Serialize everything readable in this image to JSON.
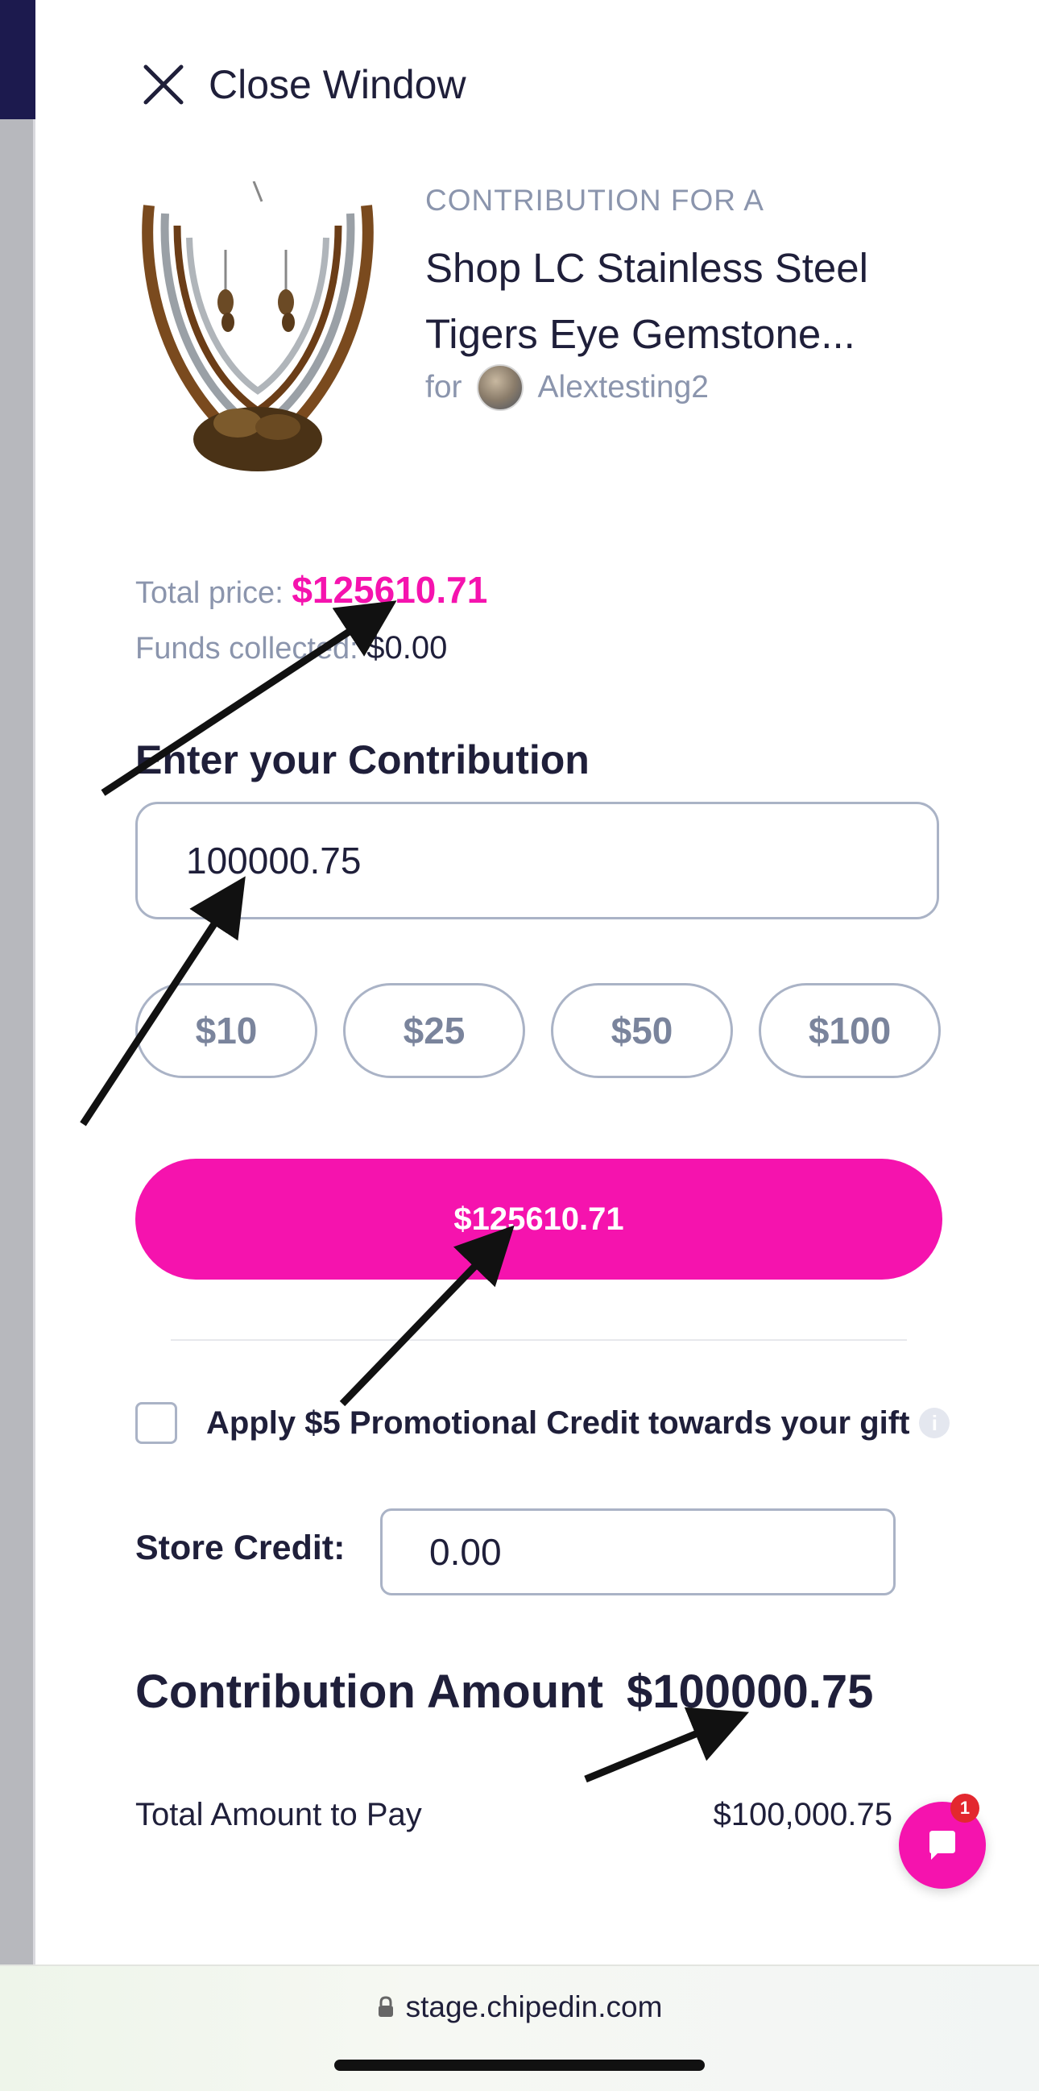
{
  "header": {
    "close_label": "Close Window"
  },
  "product": {
    "pre_title": "CONTRIBUTION FOR A",
    "title": "Shop LC Stainless Steel Tigers Eye Gemstone...",
    "for_prefix": "for",
    "recipient": "Alextesting2"
  },
  "summary": {
    "total_price_label": "Total price:",
    "total_price_value": "$125610.71",
    "funds_label": "Funds collected:",
    "funds_value": "$0.00"
  },
  "contribution": {
    "label": "Enter your Contribution",
    "input_value": "100000.75",
    "chips": [
      "$10",
      "$25",
      "$50",
      "$100"
    ],
    "pay_button": "$125610.71"
  },
  "promo": {
    "text": "Apply $5 Promotional Credit towards your gift"
  },
  "store_credit": {
    "label": "Store Credit:",
    "value": "0.00"
  },
  "totals": {
    "contribution_amount_label": "Contribution Amount",
    "contribution_amount_value": "$100000.75",
    "total_pay_label": "Total Amount to Pay",
    "total_pay_value": "$100,000.75"
  },
  "chat": {
    "badge_count": "1"
  },
  "browser": {
    "url": "stage.chipedin.com"
  },
  "colors": {
    "accent": "#f513ae",
    "text": "#1f1f3a",
    "muted": "#8b95ad",
    "border": "#aab3c6"
  }
}
